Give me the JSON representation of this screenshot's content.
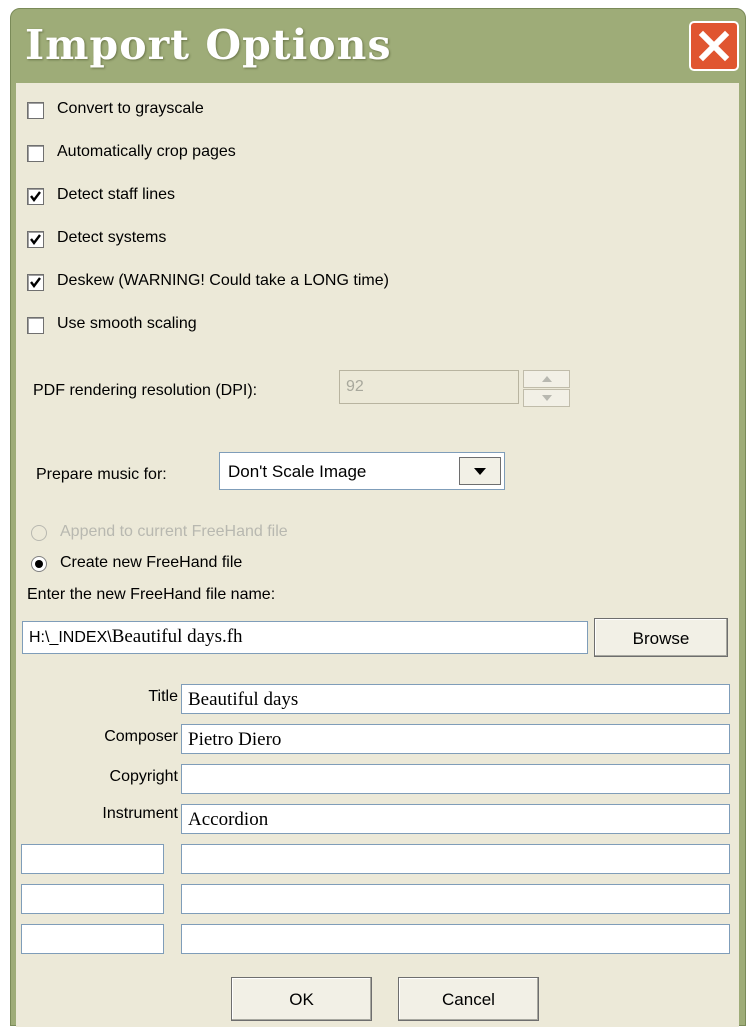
{
  "window": {
    "title": "Import Options"
  },
  "options": {
    "grayscale": {
      "label": "Convert to grayscale",
      "checked": false
    },
    "autocrop": {
      "label": "Automatically crop pages",
      "checked": false
    },
    "staff_lines": {
      "label": "Detect staff lines",
      "checked": true
    },
    "systems": {
      "label": "Detect systems",
      "checked": true
    },
    "deskew": {
      "label": "Deskew (WARNING! Could take a LONG time)",
      "checked": true
    },
    "smooth": {
      "label": "Use smooth scaling",
      "checked": false
    }
  },
  "pdf": {
    "label": "PDF rendering resolution (DPI):",
    "value": "92"
  },
  "prepare": {
    "label": "Prepare music for:",
    "selected": "Don't Scale Image"
  },
  "file_mode": {
    "append": {
      "label": "Append to current FreeHand file",
      "enabled": false,
      "selected": false
    },
    "create": {
      "label": "Create new FreeHand file",
      "enabled": true,
      "selected": true
    }
  },
  "filename": {
    "label": "Enter the new FreeHand file name:",
    "path_prefix": "H:\\_INDEX\\",
    "name": "Beautiful days.fh",
    "browse_label": "Browse"
  },
  "metadata": {
    "title": {
      "label": "Title",
      "value": "Beautiful days"
    },
    "composer": {
      "label": "Composer",
      "value": "Pietro Diero"
    },
    "copyright": {
      "label": "Copyright",
      "value": ""
    },
    "instrument": {
      "label": "Instrument",
      "value": "Accordion"
    },
    "custom": [
      {
        "key": "",
        "value": ""
      },
      {
        "key": "",
        "value": ""
      },
      {
        "key": "",
        "value": ""
      }
    ]
  },
  "buttons": {
    "ok": "OK",
    "cancel": "Cancel"
  }
}
